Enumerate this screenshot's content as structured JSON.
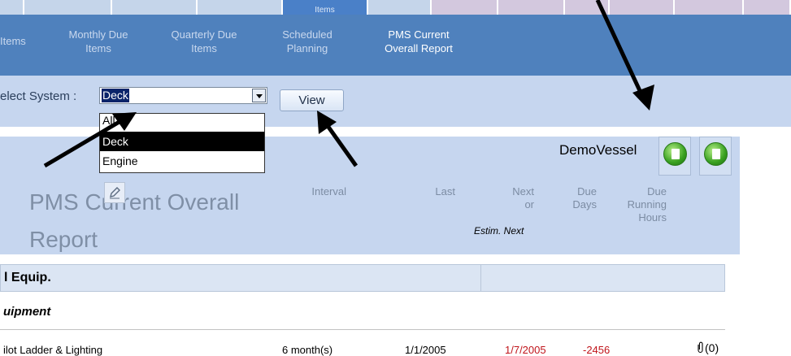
{
  "tabs": {
    "active_label": "Items"
  },
  "nav": {
    "items": [
      {
        "label": "Items"
      },
      {
        "label": "Monthly Due Items"
      },
      {
        "label": "Quarterly Due Items"
      },
      {
        "label": "Scheduled Planning"
      },
      {
        "label": "PMS Current Overall Report"
      }
    ]
  },
  "filter": {
    "label": "elect System :",
    "selected_value": "Deck",
    "view_button_label": "View",
    "options": [
      "All>",
      "Deck",
      "Engine"
    ]
  },
  "report": {
    "vessel_name": "DemoVessel",
    "title": "PMS Current Overall Report",
    "columns": {
      "interval": "Interval",
      "last": "Last",
      "next": "Next or",
      "due_days": "Due Days",
      "due_running_hours": "Due Running Hours",
      "estim_next": "Estim. Next"
    },
    "group_label": "l Equip.",
    "subgroup_label": "uipment",
    "rows": [
      {
        "item": "ilot Ladder & Lighting",
        "interval": "6 month(s)",
        "last": "1/1/2005",
        "next": "1/7/2005",
        "due_days": "-2456",
        "attachments": "(0)"
      }
    ]
  },
  "colors": {
    "nav_bar": "#4f81bd",
    "light_band": "#c6d6ef",
    "overdue": "#c0151b",
    "tab_inactive_blue": "#c5d5ea",
    "tab_inactive_purple": "#d3c8de"
  }
}
